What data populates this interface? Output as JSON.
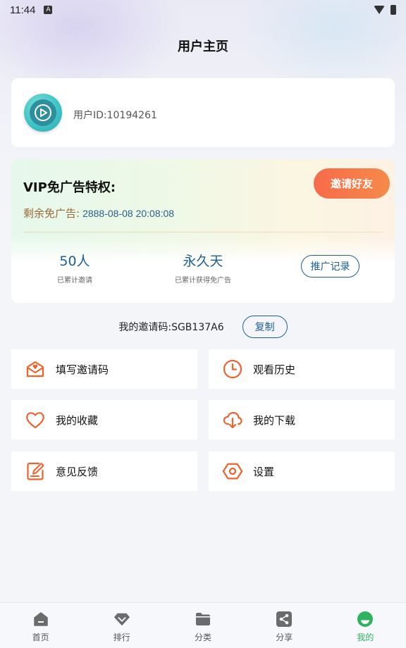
{
  "status_bar": {
    "time": "11:44",
    "indicator": "A"
  },
  "header": {
    "title": "用户主页"
  },
  "user": {
    "id_text": "用户ID:10194261"
  },
  "vip": {
    "title": "VIP免广告特权:",
    "invite_button": "邀请好友",
    "remaining_label": "剩余免广告:",
    "remaining_date": "2888-08-08 20:08:08",
    "stats": [
      {
        "value": "50人",
        "label": "已累计邀请"
      },
      {
        "value": "永久天",
        "label": "已累计获得免广告"
      }
    ],
    "record_button": "推广记录"
  },
  "invite_code": {
    "text": "我的邀请码:SGB137A6",
    "copy_button": "复制"
  },
  "menu": [
    {
      "label": "填写邀请码",
      "icon": "envelope-heart-icon"
    },
    {
      "label": "观看历史",
      "icon": "clock-icon"
    },
    {
      "label": "我的收藏",
      "icon": "heart-icon"
    },
    {
      "label": "我的下载",
      "icon": "cloud-download-icon"
    },
    {
      "label": "意见反馈",
      "icon": "edit-icon"
    },
    {
      "label": "设置",
      "icon": "settings-hexagon-icon"
    }
  ],
  "bottom_nav": {
    "items": [
      {
        "label": "首页",
        "icon": "home-icon"
      },
      {
        "label": "排行",
        "icon": "diamond-icon"
      },
      {
        "label": "分类",
        "icon": "folder-icon"
      },
      {
        "label": "分享",
        "icon": "share-icon"
      },
      {
        "label": "我的",
        "icon": "profile-icon"
      }
    ],
    "active_index": 4
  },
  "colors": {
    "accent_orange": "#f76b4a",
    "link_blue": "#1d5f94",
    "active_green": "#2db35d",
    "icon_orange": "#f0622e"
  }
}
